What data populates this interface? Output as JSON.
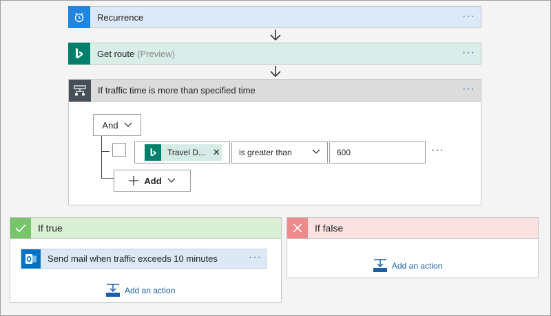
{
  "recurrence": {
    "title": "Recurrence",
    "icon": "alarm-clock-icon",
    "color": "#1f85e0"
  },
  "get_route": {
    "title": "Get route",
    "subtitle": "(Preview)",
    "icon": "bing-icon",
    "color": "#00806a"
  },
  "condition": {
    "title": "If traffic time is more than specified time",
    "icon": "condition-icon",
    "group_operator": "And",
    "row": {
      "token_label": "Travel D...",
      "operator": "is greater than",
      "value": "600"
    },
    "add_label": "Add"
  },
  "if_true": {
    "title": "If true",
    "color": "#77c56a",
    "action": {
      "title": "Send mail when traffic exceeds 10 minutes",
      "icon": "outlook-icon",
      "color": "#0072c6"
    },
    "add_action_label": "Add an action"
  },
  "if_false": {
    "title": "If false",
    "color": "#ef8a8a",
    "add_action_label": "Add an action"
  },
  "menu_dots": "···"
}
